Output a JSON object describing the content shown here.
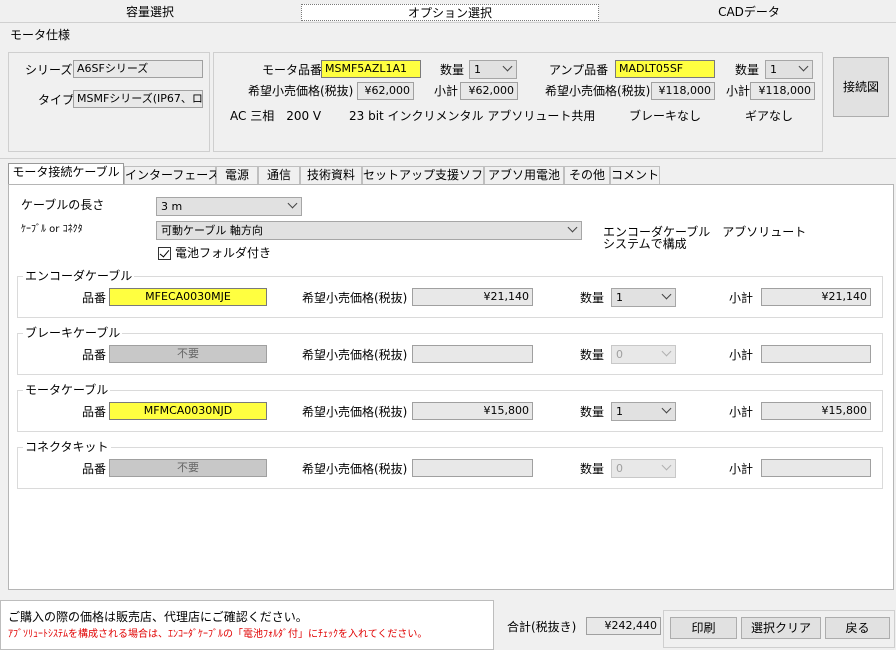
{
  "top_tabs": [
    "容量選択",
    "オプション選択",
    "CADデータ"
  ],
  "motor_spec": {
    "group_label": "モータ仕様",
    "series_label": "シリーズ",
    "series_value": "A6SFシリーズ",
    "type_label": "タイプ",
    "type_value": "MSMFシリーズ(IP67、ロ",
    "motor_part_label": "モータ品番",
    "motor_part_value": "MSMF5AZL1A1",
    "qty_label": "数量",
    "motor_qty": "1",
    "amp_part_label": "アンプ品番",
    "amp_part_value": "MADLT05SF",
    "amp_qty": "1",
    "price_label": "希望小売価格(税抜)",
    "motor_price": "¥62,000",
    "subtotal_label": "小計",
    "motor_subtotal": "¥62,000",
    "amp_price": "¥118,000",
    "amp_subtotal": "¥118,000",
    "power": "AC 三相　200 V",
    "encoder": "23 bit インクリメンタル アブソリュート共用",
    "brake": "ブレーキなし",
    "gear": "ギアなし",
    "diagram_button": "接続図"
  },
  "tabs": [
    "モータ接続ケーブル",
    "インターフェース",
    "電源",
    "通信",
    "技術資料",
    "セットアップ支援ソフト",
    "アブソ用電池",
    "その他",
    "コメント"
  ],
  "cable": {
    "length_label": "ケーブルの長さ",
    "length_value": "3 m",
    "connector_label": "ｹｰﾌﾞﾙ or ｺﾈｸﾀ",
    "connector_value": "可動ケーブル 軸方向",
    "battery_label": "電池フォルダ付き",
    "note": "エンコーダケーブル　アブソリュート\nシステムで構成"
  },
  "sections": [
    {
      "title": "エンコーダケーブル",
      "part": "MFECA0030MJE",
      "price": "¥21,140",
      "qty": "1",
      "subtotal": "¥21,140",
      "enabled": true
    },
    {
      "title": "ブレーキケーブル",
      "part": "不要",
      "price": "",
      "qty": "0",
      "subtotal": "",
      "enabled": false
    },
    {
      "title": "モータケーブル",
      "part": "MFMCA0030NJD",
      "price": "¥15,800",
      "qty": "1",
      "subtotal": "¥15,800",
      "enabled": true
    },
    {
      "title": "コネクタキット",
      "part": "不要",
      "price": "",
      "qty": "0",
      "subtotal": "",
      "enabled": false
    }
  ],
  "row_labels": {
    "part": "品番",
    "price": "希望小売価格(税抜)",
    "qty": "数量",
    "subtotal": "小計"
  },
  "footer": {
    "note1": "ご購入の際の価格は販売店、代理店にご確認ください。",
    "note2": "ｱﾌﾞｿﾘｭｰﾄｼｽﾃﾑを構成される場合は、ｴﾝｺｰﾀﾞｹｰﾌﾞﾙの「電池ﾌｫﾙﾀﾞ付」にﾁｪｯｸを入れてください。",
    "total_label": "合計(税抜き)",
    "total_value": "¥242,440",
    "print": "印刷",
    "clear": "選択クリア",
    "back": "戻る"
  },
  "colors": {
    "highlight": "#ffff40",
    "warning": "#e00000"
  }
}
